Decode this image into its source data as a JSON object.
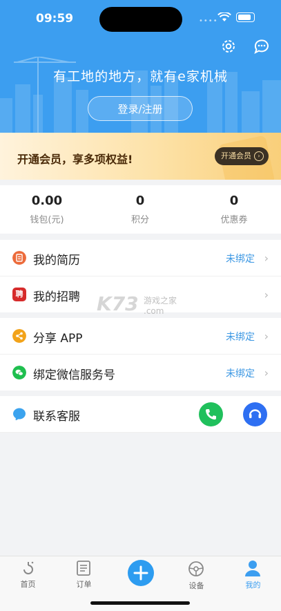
{
  "status_bar": {
    "time": "09:59"
  },
  "header": {
    "slogan": "有工地的地方，就有e家机械",
    "login_label": "登录/注册",
    "icons": {
      "settings": "gear-icon",
      "messages": "chat-bubble-icon"
    }
  },
  "vip": {
    "title": "开通会员，享多项权益!",
    "button_label": "开通会员"
  },
  "stats": [
    {
      "value": "0.00",
      "label": "钱包(元)"
    },
    {
      "value": "0",
      "label": "积分"
    },
    {
      "value": "0",
      "label": "优惠券"
    }
  ],
  "menu_group_1": [
    {
      "label": "我的简历",
      "status": "未绑定",
      "icon": "resume-icon",
      "color": "#ec6b3b"
    },
    {
      "label": "我的招聘",
      "status": "",
      "icon": "recruit-icon",
      "color": "#d62b2b",
      "icon_text": "聘"
    }
  ],
  "menu_group_2": [
    {
      "label": "分享 APP",
      "status": "未绑定",
      "icon": "share-icon",
      "color": "#f2a31a"
    },
    {
      "label": "绑定微信服务号",
      "status": "未绑定",
      "icon": "wechat-icon",
      "color": "#1fbf4f"
    }
  ],
  "contact": {
    "label": "联系客服",
    "phone_color": "#20c05c",
    "support_color": "#2e6ff2"
  },
  "watermark": {
    "main": "K73",
    "sub": "游戏之家",
    "domain": ".com"
  },
  "tabs": [
    {
      "label": "首页",
      "icon": "home-hook-icon",
      "active": false
    },
    {
      "label": "订单",
      "icon": "order-list-icon",
      "active": false
    },
    {
      "label": "",
      "icon": "plus-icon",
      "active": false
    },
    {
      "label": "设备",
      "icon": "steering-wheel-icon",
      "active": false
    },
    {
      "label": "我的",
      "icon": "user-icon",
      "active": true
    }
  ],
  "colors": {
    "primary": "#3c9ef0",
    "link": "#3b97e3",
    "active_tab": "#3c9ef0"
  }
}
